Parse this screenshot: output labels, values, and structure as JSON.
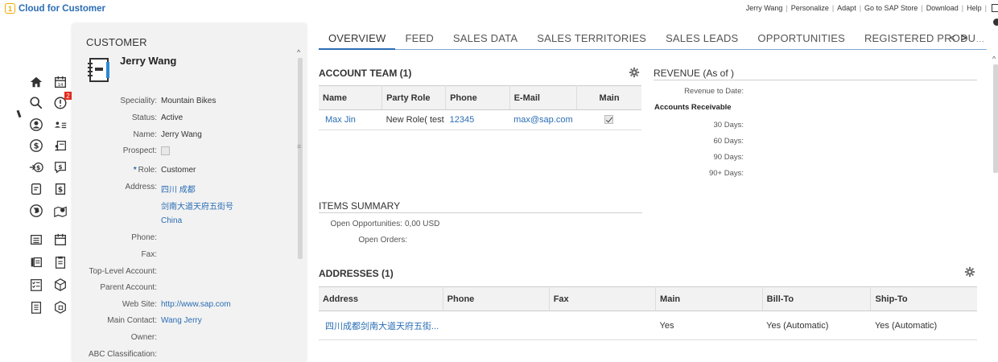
{
  "app": {
    "title": "Cloud for Customer",
    "top_links": [
      "Jerry Wang",
      "Personalize",
      "Adapt",
      "Go to SAP Store",
      "Download",
      "Help"
    ]
  },
  "left_nav": {
    "icons": [
      "home-icon",
      "calendar-icon",
      "search-icon",
      "alert-icon",
      "person-icon",
      "people-list-icon",
      "dollar-icon",
      "contacts-card-icon",
      "transfer-dollar-icon",
      "invoice-icon",
      "document-icon",
      "money-doc-icon",
      "globe-icon",
      "map-pin-icon",
      "list-icon",
      "calendar-clock-icon",
      "book-icon",
      "clipboard-icon",
      "checklist-icon",
      "box-icon",
      "report-icon",
      "package-icon"
    ],
    "alert_badge": "2"
  },
  "customer": {
    "section_title": "CUSTOMER",
    "name": "Jerry Wang",
    "fields": [
      {
        "label": "Speciality:",
        "value": "Mountain Bikes"
      },
      {
        "label": "Status:",
        "value": "Active"
      },
      {
        "label": "Name:",
        "value": "Jerry Wang"
      },
      {
        "label": "Prospect:",
        "value": ""
      },
      {
        "label": "Role:",
        "value": "Customer"
      },
      {
        "label": "Address:",
        "value": "四川 成都"
      },
      {
        "label": "",
        "value": "剑南大道天府五街号"
      },
      {
        "label": "",
        "value": "China"
      },
      {
        "label": "Phone:",
        "value": ""
      },
      {
        "label": "Fax:",
        "value": ""
      },
      {
        "label": "Top-Level Account:",
        "value": ""
      },
      {
        "label": "Parent Account:",
        "value": ""
      },
      {
        "label": "Web Site:",
        "value": "http://www.sap.com"
      },
      {
        "label": "Main Contact:",
        "value": "Wang Jerry"
      },
      {
        "label": "Owner:",
        "value": ""
      },
      {
        "label": "ABC Classification:",
        "value": ""
      }
    ]
  },
  "tabs": [
    "OVERVIEW",
    "FEED",
    "SALES DATA",
    "SALES TERRITORIES",
    "SALES LEADS",
    "OPPORTUNITIES",
    "REGISTERED PRODU"
  ],
  "tabs_more": "...",
  "account_team": {
    "title": "ACCOUNT TEAM (1)",
    "columns": [
      "Name",
      "Party Role",
      "Phone",
      "E-Mail",
      "Main"
    ],
    "rows": [
      {
        "name": "Max Jin",
        "role": "New Role( test b...",
        "phone": "12345",
        "email": "max@sap.com",
        "main": true
      }
    ]
  },
  "revenue": {
    "title": "REVENUE (As of )",
    "revenue_to_date": "Revenue to Date:",
    "ar_title": "Accounts Receivable",
    "days": [
      "30 Days:",
      "60 Days:",
      "90 Days:",
      "90+ Days:"
    ]
  },
  "items_summary": {
    "title": "ITEMS SUMMARY",
    "open_opportunities_label": "Open Opportunities:",
    "open_opportunities_value": "0,00 USD",
    "open_orders_label": "Open Orders:"
  },
  "addresses": {
    "title": "ADDRESSES (1)",
    "columns": [
      "Address",
      "Phone",
      "Fax",
      "Main",
      "Bill-To",
      "Ship-To"
    ],
    "rows": [
      {
        "address": "四川成都剑南大道天府五街...",
        "phone": "",
        "fax": "",
        "main": "Yes",
        "bill_to": "Yes (Automatic)",
        "ship_to": "Yes (Automatic)"
      }
    ]
  }
}
